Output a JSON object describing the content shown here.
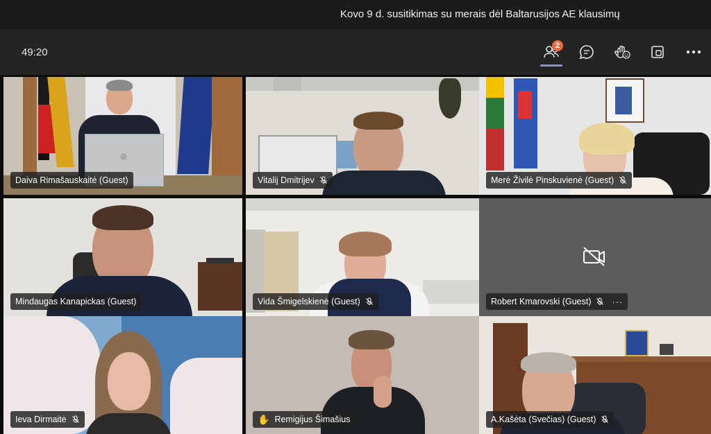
{
  "meeting": {
    "title": "Kovo 9 d. susitikimas su merais dėl Baltarusijos AE klausimų",
    "timer": "49:20"
  },
  "toolbar": {
    "participants_icon": "people-icon",
    "participants_count": "2",
    "chat_icon": "chat-icon",
    "reactions_icon": "reactions-icon",
    "share_icon": "share-tray-icon",
    "more_icon": "more-options-icon",
    "badge_color": "#e86a3e",
    "active_color": "#8b8fd8"
  },
  "participants": [
    {
      "name": "Daiva Rimašauskaitė (Guest)",
      "muted": false
    },
    {
      "name": "Vitalij Dmitrijev",
      "muted": true
    },
    {
      "name": "Merė Živilė Pinskuvienė (Guest)",
      "muted": true
    },
    {
      "name": "Mindaugas Kanapickas (Guest)",
      "muted": false
    },
    {
      "name": "Vida Šmigelskienė (Guest)",
      "muted": true
    },
    {
      "name": "Robert Kmarovski (Guest)",
      "muted": true,
      "camera_off": true,
      "more": "···"
    },
    {
      "name": "Ieva Dirmaitė",
      "muted": true
    },
    {
      "name": "Remigijus Šimašius",
      "muted": false,
      "hand_raised": true
    },
    {
      "name": "A.Kašėta (Svečias) (Guest)",
      "muted": true
    }
  ]
}
